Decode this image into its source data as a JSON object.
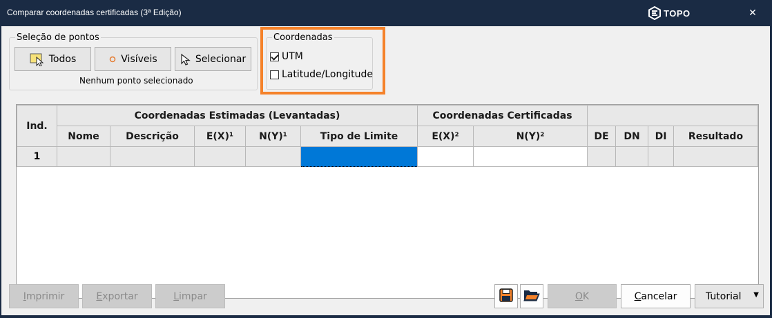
{
  "window": {
    "title": "Comparar coordenadas certificadas (3ª Edição)",
    "logo_text": "TOPO",
    "close_glyph": "✕"
  },
  "selection_group": {
    "legend": "Seleção de pontos",
    "buttons": [
      {
        "label": "Todos",
        "icon": "select-all-icon"
      },
      {
        "label": "Visíveis",
        "icon": "visible-points-icon"
      },
      {
        "label": "Selecionar",
        "icon": "cursor-select-icon"
      }
    ],
    "status": "Nenhum ponto selecionado"
  },
  "coordinates_group": {
    "legend": "Coordenadas",
    "options": [
      {
        "label": "UTM",
        "checked": true
      },
      {
        "label": "Latitude/Longitude",
        "checked": false
      }
    ]
  },
  "grid": {
    "headers": {
      "ind": "Ind.",
      "estimated_group": "Coordenadas Estimadas (Levantadas)",
      "certified_group": "Coordenadas Certificadas",
      "columns": [
        "Nome",
        "Descrição",
        "E(X)¹",
        "N(Y)¹",
        "Tipo de Limite",
        "E(X)²",
        "N(Y)²",
        "DE",
        "DN",
        "DI",
        "Resultado"
      ]
    },
    "rows": [
      {
        "ind": "1"
      }
    ]
  },
  "footer": {
    "print": {
      "first": "I",
      "rest": "mprimir"
    },
    "export": {
      "first": "E",
      "rest": "xportar"
    },
    "clear": {
      "first": "L",
      "rest": "impar"
    },
    "save_icon": "save-disk-icon",
    "open_icon": "open-folder-icon",
    "ok": {
      "first": "O",
      "rest": "K"
    },
    "cancel": {
      "first": "C",
      "rest": "ancelar"
    },
    "tutorial": "Tutorial",
    "tutorial_arrow": "▼"
  },
  "colors": {
    "titlebar": "#1a2b44",
    "highlight": "#f5822a",
    "selected_cell": "#0078d7"
  }
}
